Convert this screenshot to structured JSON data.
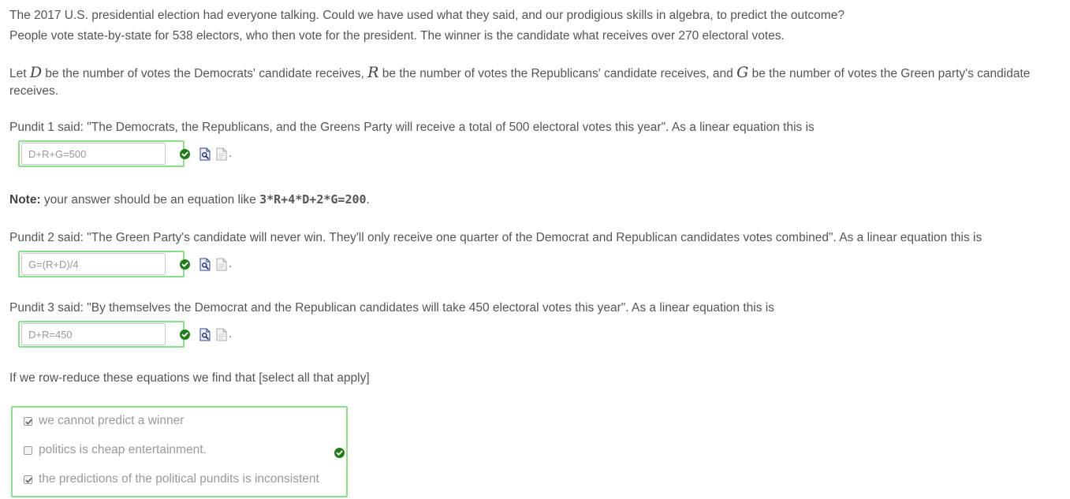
{
  "intro": {
    "line1": "The 2017 U.S. presidential election had everyone talking. Could we have used what they said, and our prodigious skills in algebra, to predict the outcome?",
    "line2": "People vote state-by-state for 538 electors, who then vote for the president. The winner is the candidate what receives over 270 electoral votes."
  },
  "variables": {
    "p1": "Let ",
    "d": "D",
    "p2": " be the number of votes the Democrats' candidate receives, ",
    "r": "R",
    "p3": " be the number of votes the Republicans' candidate receives, and ",
    "g": "G",
    "p4": " be the number of votes the Green party's candidate receives."
  },
  "pundit1": {
    "text": "Pundit 1 said: \"The Democrats, the Republicans, and the Greens Party will receive a total of 500 electoral votes this year\". As a linear equation this is",
    "answer": "D+R+G=500"
  },
  "note": {
    "label": "Note:",
    "text": " your answer should be an equation like ",
    "example": "3*R+4*D+2*G=200",
    "end": "."
  },
  "pundit2": {
    "text": "Pundit 2 said: \"The Green Party's candidate will never win. They'll only receive one quarter of the Democrat and Republican candidates votes combined\". As a linear equation this is",
    "answer": "G=(R+D)/4"
  },
  "pundit3": {
    "text": "Pundit 3 said: \"By themselves the Democrat and the Republican candidates will take 450 electoral votes this year\". As a linear equation this is",
    "answer": "D+R=450"
  },
  "period": ".",
  "rowreduce": {
    "text": "If we row-reduce these equations we find that [select all that apply]"
  },
  "choices": [
    {
      "label": "we cannot predict a winner",
      "checked": true
    },
    {
      "label": "politics is cheap entertainment.",
      "checked": false
    },
    {
      "label": "the predictions of the political pundits is inconsistent",
      "checked": true
    }
  ],
  "icons": {
    "correct": "check-circle-icon",
    "preview": "preview-icon",
    "help": "help-document-icon"
  },
  "colors": {
    "correct_border": "#88e088",
    "correct_check": "#1e7d16",
    "text": "#555555"
  }
}
